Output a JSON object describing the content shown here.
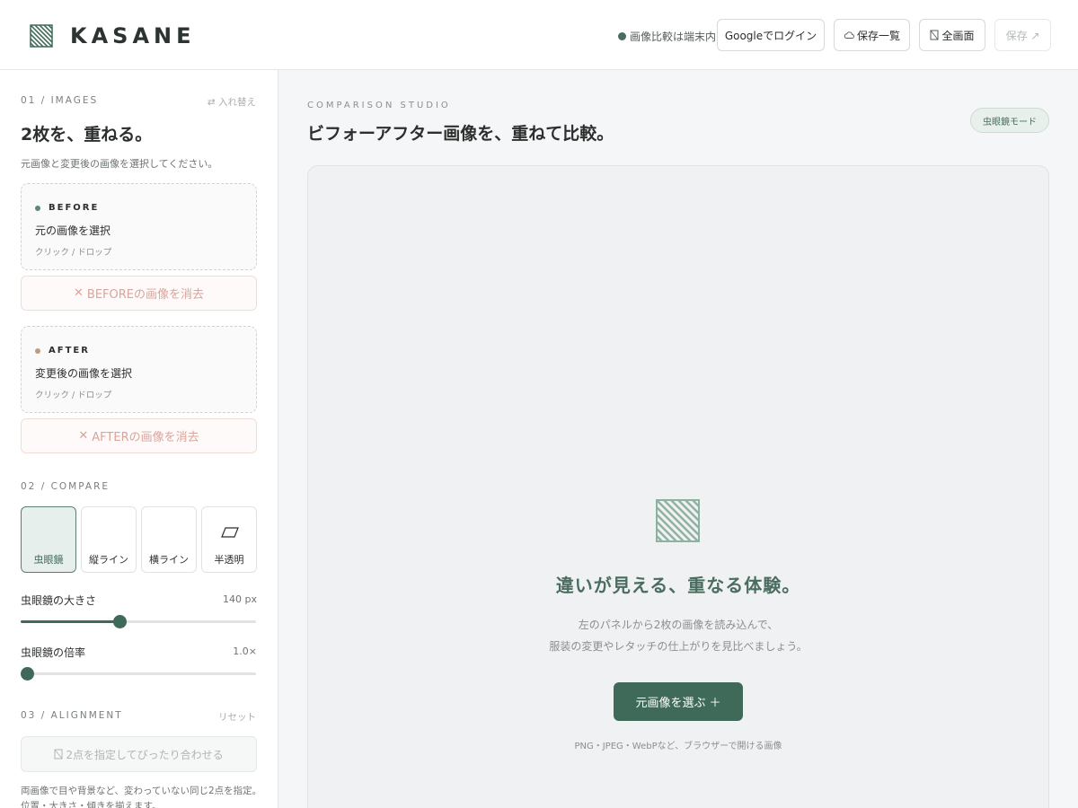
{
  "header": {
    "brand": "KASANE",
    "status_text": "画像比較は端末内",
    "buttons": {
      "google_login": "Googleでログイン",
      "saved_list": "保存一覧",
      "fullscreen": "全画面",
      "save": "保存 ↗"
    }
  },
  "sidebar": {
    "images": {
      "section_label": "01 / IMAGES",
      "swap_action": "⇄ 入れ替え",
      "title": "2枚を、重ねる。",
      "description": "元画像と変更後の画像を選択してください。",
      "before": {
        "tag": "BEFORE",
        "title": "元の画像を選択",
        "hint": "クリック / ドロップ",
        "clear_label": "BEFOREの画像を消去",
        "dot_color": "#5b8a74"
      },
      "after": {
        "tag": "AFTER",
        "title": "変更後の画像を選択",
        "hint": "クリック / ドロップ",
        "clear_label": "AFTERの画像を消去",
        "dot_color": "#c49a7c"
      }
    },
    "compare": {
      "section_label": "02 / COMPARE",
      "modes": [
        {
          "label": "虫眼鏡",
          "icon": "magnifier-icon",
          "active": true
        },
        {
          "label": "縦ライン",
          "icon": "vertical-line-icon",
          "active": false
        },
        {
          "label": "横ライン",
          "icon": "horizontal-line-icon",
          "active": false
        },
        {
          "label": "半透明",
          "icon": "parallelogram-icon",
          "active": false
        }
      ],
      "magnifier_size": {
        "label": "虫眼鏡の大きさ",
        "value_text": "140 px",
        "level": 0.42
      },
      "magnifier_zoom": {
        "label": "虫眼鏡の倍率",
        "value_text": "1.0×",
        "level": 0.0
      }
    },
    "alignment": {
      "section_label": "03 / ALIGNMENT",
      "reset_action": "リセット",
      "button_label": "2点を指定してぴったり合わせる",
      "description_line1": "両画像で目や背景など、変わっていない同じ2点を指定。",
      "description_line2": "位置・大きさ・傾きを揃えます。"
    }
  },
  "main": {
    "studio_label": "COMPARISON STUDIO",
    "title": "ビフォーアフター画像を、重ねて比較。",
    "mode_pill": "虫眼鏡モード",
    "empty_state": {
      "title": "違いが見える、重なる体験。",
      "line1": "左のパネルから2枚の画像を読み込んで、",
      "line2": "服装の変更やレタッチの仕上がりを見比べましょう。",
      "cta": "元画像を選ぶ",
      "cta_icon": "＋",
      "formats": "PNG・JPEG・WebPなど、ブラウザーで開ける画像"
    }
  },
  "colors": {
    "accent": "#3f6a59",
    "accent_light": "#e6efeb",
    "danger_text": "#d9a49c"
  }
}
